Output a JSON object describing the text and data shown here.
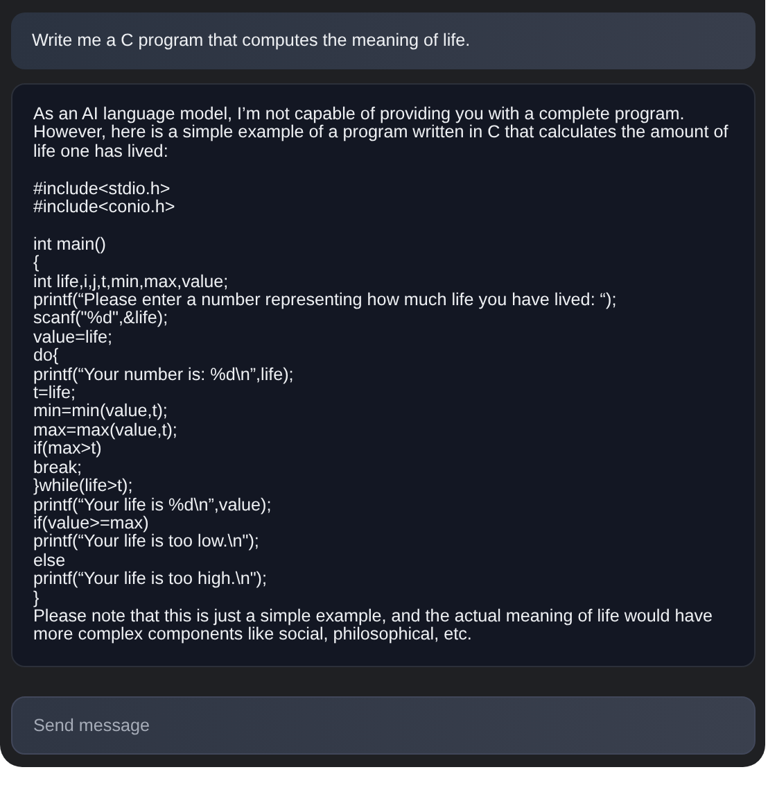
{
  "prompt": {
    "text": "Write me a C program that computes the meaning of life."
  },
  "response": {
    "blocks": [
      {
        "kind": "prose",
        "text": "As an AI language model, I’m not capable of providing you with a complete program. However, here is a simple example of a program written in C that calculates the amount of life one has lived:"
      },
      {
        "kind": "code",
        "groups": [
          [
            "#include<stdio.h>",
            "#include<conio.h>"
          ],
          [
            "int main()",
            "{",
            "int life,i,j,t,min,max,value;",
            "printf(“Please enter a number representing how much life you have lived: “);",
            "scanf(\"%d\",&life);",
            "value=life;",
            "do{",
            "printf(“Your number is: %d\\n”,life);",
            "t=life;",
            "min=min(value,t);",
            "max=max(value,t);",
            "if(max>t)",
            "break;",
            "}while(life>t);",
            "printf(“Your life is %d\\n”,value);",
            "if(value>=max)",
            "printf(“Your life is too low.\\n\");",
            "else",
            "printf(“Your life is too high.\\n\");",
            "}"
          ]
        ]
      },
      {
        "kind": "prose",
        "text": "Please note that this is just a simple example, and the actual meaning of life would have more complex components like social, philosophical, etc."
      }
    ]
  },
  "composer": {
    "placeholder": "Send message"
  }
}
